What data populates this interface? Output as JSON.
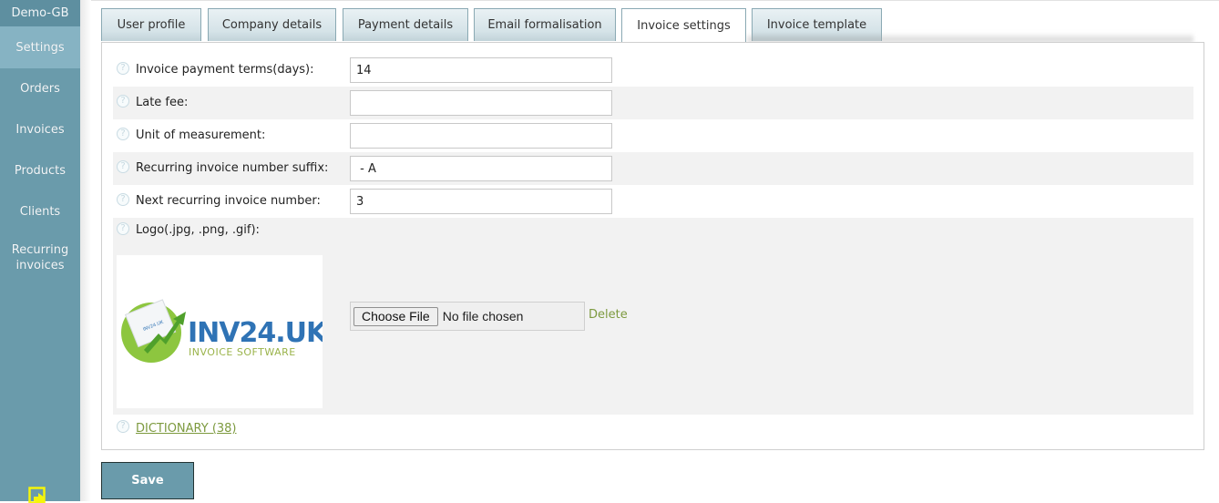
{
  "sidebar": {
    "brand": "Demo-GB",
    "items": [
      {
        "label": "Settings",
        "active": true
      },
      {
        "label": "Orders",
        "active": false
      },
      {
        "label": "Invoices",
        "active": false
      },
      {
        "label": "Products",
        "active": false
      },
      {
        "label": "Clients",
        "active": false
      },
      {
        "label": "Recurring invoices",
        "active": false
      }
    ],
    "logout_icon": "logout-icon"
  },
  "tabs": [
    {
      "label": "User profile",
      "active": false
    },
    {
      "label": "Company details",
      "active": false
    },
    {
      "label": "Payment details",
      "active": false
    },
    {
      "label": "Email formalisation",
      "active": false
    },
    {
      "label": "Invoice settings",
      "active": true
    },
    {
      "label": "Invoice template",
      "active": false
    }
  ],
  "form": {
    "fields": [
      {
        "label": "Invoice payment terms(days):",
        "value": "14"
      },
      {
        "label": "Late fee:",
        "value": ""
      },
      {
        "label": "Unit of measurement:",
        "value": ""
      },
      {
        "label": "Recurring invoice number suffix:",
        "value": " - A"
      },
      {
        "label": "Next recurring invoice number:",
        "value": "3"
      }
    ],
    "logo": {
      "label": "Logo(.jpg, .png, .gif):",
      "image_brand": "INV24.UK",
      "image_tagline": "INVOICE SOFTWARE",
      "image_doc_text": "INV24.UK",
      "choose_file_label": "Choose File",
      "file_status": "No file chosen",
      "delete_label": "Delete"
    },
    "dictionary_link": "DICTIONARY (38)",
    "help_icon_glyph": "?"
  },
  "save_label": "Save",
  "colors": {
    "sidebar": "#6a9bab",
    "sidebar_active": "#86b3c3",
    "link_green": "#7d9a3f",
    "logo_blue": "#2f73b5",
    "logo_green": "#8dc63f"
  }
}
